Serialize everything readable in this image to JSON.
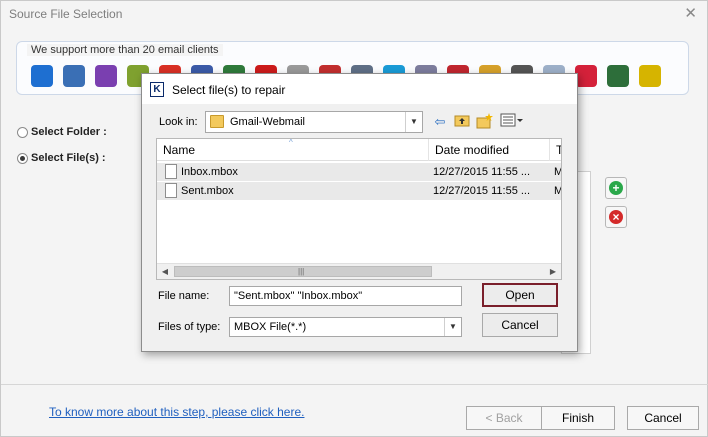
{
  "window": {
    "title": "Source File Selection",
    "close_glyph": "✕"
  },
  "clients": {
    "caption": "We support more than 20 email clients",
    "icons": [
      {
        "name": "mail-icon",
        "color": "#1e6fd1"
      },
      {
        "name": "thunderbird-icon",
        "color": "#3a6fb5"
      },
      {
        "name": "entourage-icon",
        "color": "#7a3fb0"
      },
      {
        "name": "client-icon",
        "color": "#7fa12f"
      },
      {
        "name": "gmail-icon",
        "color": "#d93025"
      },
      {
        "name": "client-icon",
        "color": "#3b5ba8"
      },
      {
        "name": "client-icon",
        "color": "#2f7a3b"
      },
      {
        "name": "opera-icon",
        "color": "#cc1b1b"
      },
      {
        "name": "client-icon",
        "color": "#9a9a9a"
      },
      {
        "name": "client-icon",
        "color": "#c22f2f"
      },
      {
        "name": "client-icon",
        "color": "#5f6f86"
      },
      {
        "name": "client-icon",
        "color": "#1a9bd6"
      },
      {
        "name": "client-icon",
        "color": "#7d7d9d"
      },
      {
        "name": "client-icon",
        "color": "#c0262f"
      },
      {
        "name": "client-icon",
        "color": "#d6a12a"
      },
      {
        "name": "client-icon",
        "color": "#555555"
      },
      {
        "name": "client-icon",
        "color": "#9db0c9"
      },
      {
        "name": "client-icon",
        "color": "#d4213a"
      },
      {
        "name": "client-icon",
        "color": "#2d6e3a"
      },
      {
        "name": "client-icon",
        "color": "#d6b400"
      }
    ]
  },
  "options": {
    "select_folder": "Select Folder :",
    "select_files": "Select File(s) :",
    "selected": "select_files"
  },
  "side_buttons": {
    "add_glyph": "+",
    "remove_glyph": "×",
    "add_color": "#2aa84a",
    "remove_color": "#d42a2a"
  },
  "footer": {
    "help_link": "To know more about this step, please click here.",
    "back": "< Back",
    "finish": "Finish",
    "cancel": "Cancel"
  },
  "dialog": {
    "title": "Select file(s) to repair",
    "app_icon_letter": "K",
    "look_in_label": "Look in:",
    "look_in_value": "Gmail-Webmail",
    "toolbar": [
      "back-arrow-icon",
      "up-folder-icon",
      "new-folder-icon",
      "view-menu-icon"
    ],
    "columns": [
      "Name",
      "Date modified",
      "Ty"
    ],
    "files": [
      {
        "name": "Inbox.mbox",
        "date": "12/27/2015 11:55 ...",
        "type": "M"
      },
      {
        "name": "Sent.mbox",
        "date": "12/27/2015 11:55 ...",
        "type": "M"
      }
    ],
    "scroll_grip": "|||",
    "file_name_label": "File name:",
    "file_name_value": "\"Sent.mbox\" \"Inbox.mbox\"",
    "file_type_label": "Files of type:",
    "file_type_value": "MBOX File(*.*)",
    "open": "Open",
    "cancel": "Cancel"
  }
}
